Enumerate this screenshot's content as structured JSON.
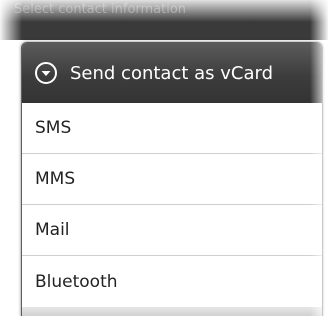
{
  "background": {
    "title": "Select contact information"
  },
  "dialog": {
    "title": "Send contact as vCard",
    "icon": "chevron-down-circle-icon",
    "items": [
      {
        "label": "SMS"
      },
      {
        "label": "MMS"
      },
      {
        "label": "Mail"
      },
      {
        "label": "Bluetooth"
      }
    ]
  },
  "colors": {
    "header_bg": "#3d3d3d",
    "divider": "#cfcfcf",
    "text": "#222222"
  }
}
